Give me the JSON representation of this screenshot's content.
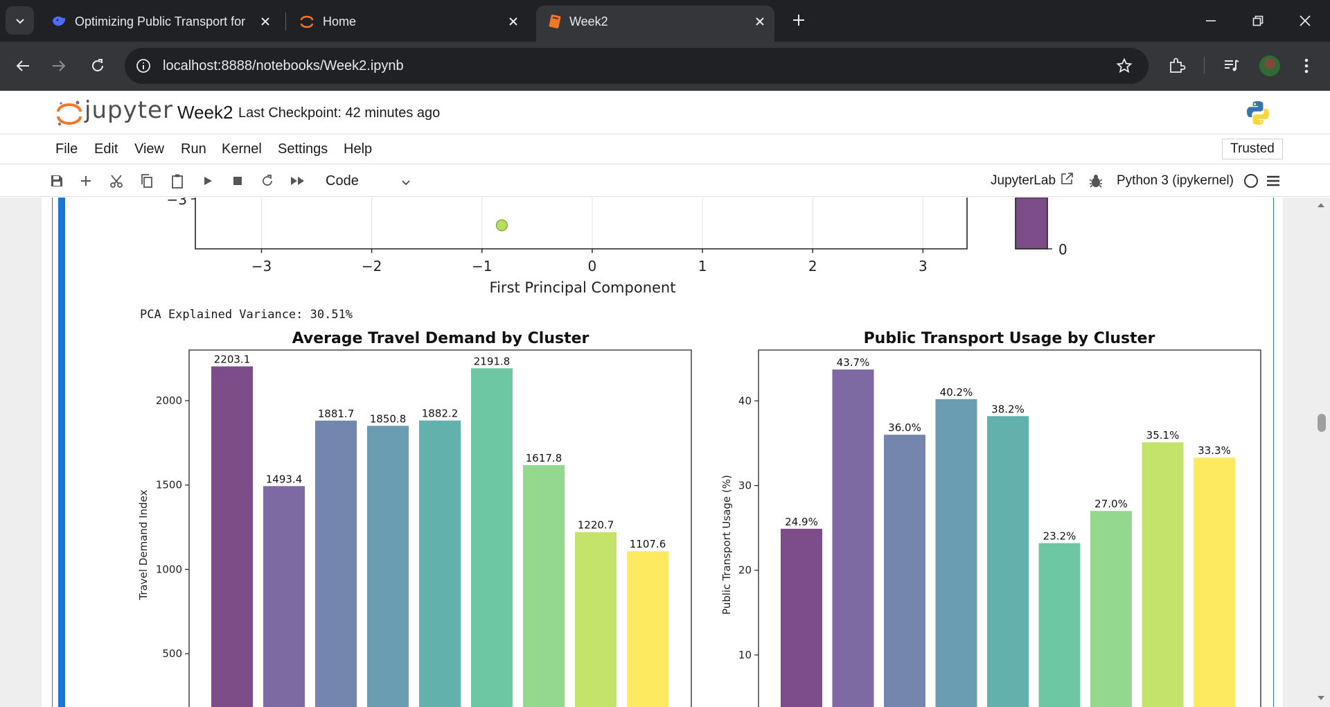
{
  "browser": {
    "tabs": [
      {
        "title": "Optimizing Public Transport for",
        "favicon": "deepseek-whale-icon",
        "active": false
      },
      {
        "title": "Home",
        "favicon": "jupyter-icon",
        "active": false
      },
      {
        "title": "Week2",
        "favicon": "notebook-icon",
        "active": true
      }
    ],
    "url": "localhost:8888/notebooks/Week2.ipynb"
  },
  "jupyter": {
    "wordmark": "jupyter",
    "notebook_name": "Week2",
    "checkpoint": "Last Checkpoint: 42 minutes ago",
    "menu": [
      "File",
      "Edit",
      "View",
      "Run",
      "Kernel",
      "Settings",
      "Help"
    ],
    "trusted": "Trusted",
    "cell_type": "Code",
    "jupyterlab_link": "JupyterLab",
    "kernel": "Python 3 (ipykernel)"
  },
  "output": {
    "pca_text": "PCA Explained Variance: 30.51%"
  },
  "colors": {
    "viridis": [
      "#7c4d89",
      "#7e6aa3",
      "#7586ae",
      "#6a9db2",
      "#62b1ad",
      "#6dc7a3",
      "#93d88e",
      "#c4e36b",
      "#fdea60"
    ],
    "accent": "#1976d2"
  },
  "chart_data": [
    {
      "type": "scatter",
      "partial": true,
      "xlabel": "First Principal Component",
      "x_ticks": [
        "−3",
        "−2",
        "−1",
        "0",
        "1",
        "2",
        "3"
      ],
      "y_ticks_visible": [
        "−3"
      ],
      "xlim": [
        -3.6,
        3.4
      ],
      "points": [
        {
          "x": -0.82,
          "y": -3.25
        }
      ],
      "colorbar_ticks_visible": [
        "0"
      ]
    },
    {
      "type": "bar",
      "title": "Average Travel Demand by Cluster",
      "ylabel": "Travel Demand Index",
      "ylim": [
        0,
        2300
      ],
      "y_ticks": [
        500,
        1000,
        1500,
        2000
      ],
      "values": [
        2203.1,
        1493.4,
        1881.7,
        1850.8,
        1882.2,
        2191.8,
        1617.8,
        1220.7,
        1107.6
      ],
      "labels": [
        "2203.1",
        "1493.4",
        "1881.7",
        "1850.8",
        "1882.2",
        "2191.8",
        "1617.8",
        "1220.7",
        "1107.6"
      ]
    },
    {
      "type": "bar",
      "title": "Public Transport Usage by Cluster",
      "ylabel": "Public Transport Usage (%)",
      "ylim": [
        0,
        46
      ],
      "y_ticks": [
        10,
        20,
        30,
        40
      ],
      "values": [
        24.9,
        43.7,
        36.0,
        40.2,
        38.2,
        23.2,
        27.0,
        35.1,
        33.3
      ],
      "labels": [
        "24.9%",
        "43.7%",
        "36.0%",
        "40.2%",
        "38.2%",
        "23.2%",
        "27.0%",
        "35.1%",
        "33.3%"
      ]
    }
  ]
}
